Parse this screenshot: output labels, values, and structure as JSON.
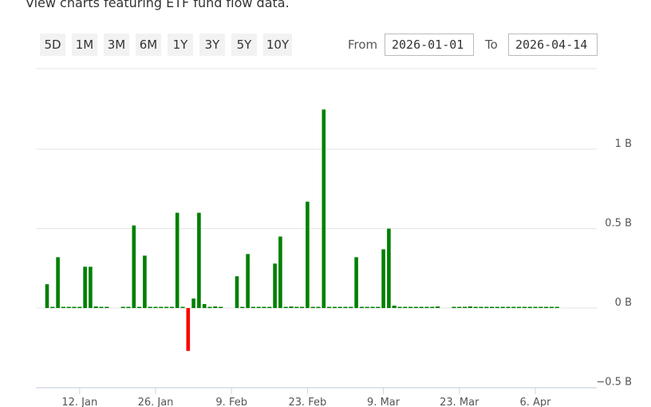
{
  "header": {
    "subtitle": "View charts featuring ETF fund flow data."
  },
  "range_buttons": [
    "5D",
    "1M",
    "3M",
    "6M",
    "1Y",
    "3Y",
    "5Y",
    "10Y"
  ],
  "date_range": {
    "from_label": "From",
    "from_value": "2026-01-01",
    "to_label": "To",
    "to_value": "2026-04-14"
  },
  "colors": {
    "positive": "#008000",
    "negative": "#ff0000"
  },
  "chart_data": {
    "type": "bar",
    "title": "",
    "xlabel": "",
    "ylabel": "",
    "x_type": "date",
    "x_range": [
      "2026-01-06",
      "2026-04-10"
    ],
    "ylim": [
      -0.5,
      1.25
    ],
    "yunit": "B",
    "y_ticks": [
      -0.5,
      0,
      0.5,
      1
    ],
    "y_tick_labels": [
      "−0.5 B",
      "0 B",
      "0.5 B",
      "1 B"
    ],
    "x_ticks": [
      "2026-01-12",
      "2026-01-26",
      "2026-02-09",
      "2026-02-23",
      "2026-03-09",
      "2026-03-23",
      "2026-04-06"
    ],
    "x_tick_labels": [
      "12. Jan",
      "26. Jan",
      "9. Feb",
      "23. Feb",
      "9. Mar",
      "23. Mar",
      "6. Apr"
    ],
    "grid": true,
    "legend": false,
    "x": [
      "2026-01-06",
      "2026-01-07",
      "2026-01-08",
      "2026-01-09",
      "2026-01-10",
      "2026-01-11",
      "2026-01-12",
      "2026-01-13",
      "2026-01-14",
      "2026-01-15",
      "2026-01-16",
      "2026-01-17",
      "2026-01-18",
      "2026-01-19",
      "2026-01-20",
      "2026-01-21",
      "2026-01-22",
      "2026-01-23",
      "2026-01-24",
      "2026-01-25",
      "2026-01-26",
      "2026-01-27",
      "2026-01-28",
      "2026-01-29",
      "2026-01-30",
      "2026-01-31",
      "2026-02-01",
      "2026-02-02",
      "2026-02-03",
      "2026-02-04",
      "2026-02-05",
      "2026-02-06",
      "2026-02-07",
      "2026-02-08",
      "2026-02-09",
      "2026-02-10",
      "2026-02-11",
      "2026-02-12",
      "2026-02-13",
      "2026-02-14",
      "2026-02-15",
      "2026-02-16",
      "2026-02-17",
      "2026-02-18",
      "2026-02-19",
      "2026-02-20",
      "2026-02-21",
      "2026-02-22",
      "2026-02-23",
      "2026-02-24",
      "2026-02-25",
      "2026-02-26",
      "2026-02-27",
      "2026-02-28",
      "2026-03-01",
      "2026-03-02",
      "2026-03-03",
      "2026-03-04",
      "2026-03-05",
      "2026-03-06",
      "2026-03-07",
      "2026-03-08",
      "2026-03-09",
      "2026-03-10",
      "2026-03-11",
      "2026-03-12",
      "2026-03-13",
      "2026-03-14",
      "2026-03-15",
      "2026-03-16",
      "2026-03-17",
      "2026-03-18",
      "2026-03-19",
      "2026-03-20",
      "2026-03-21",
      "2026-03-22",
      "2026-03-23",
      "2026-03-24",
      "2026-03-25",
      "2026-03-26",
      "2026-03-27",
      "2026-03-28",
      "2026-03-29",
      "2026-03-30",
      "2026-03-31",
      "2026-04-01",
      "2026-04-02",
      "2026-04-03",
      "2026-04-04",
      "2026-04-05",
      "2026-04-06",
      "2026-04-07",
      "2026-04-08",
      "2026-04-09",
      "2026-04-10"
    ],
    "values": [
      0.15,
      0.005,
      0.32,
      0.005,
      0.005,
      0.005,
      0.005,
      0.26,
      0.26,
      0.01,
      0.005,
      0.005,
      0,
      0,
      0.005,
      0.005,
      0.52,
      0.005,
      0.33,
      0.005,
      0.005,
      0.005,
      0.005,
      0.005,
      0.6,
      0.005,
      -0.27,
      0.06,
      0.6,
      0.025,
      0.005,
      0.01,
      0.005,
      0,
      0,
      0.2,
      0.005,
      0.34,
      0.005,
      0.005,
      0.005,
      0.005,
      0.28,
      0.45,
      0.005,
      0.01,
      0.005,
      0.005,
      0.67,
      0.005,
      0.005,
      1.25,
      0.005,
      0.005,
      0.005,
      0.005,
      0.005,
      0.32,
      0.005,
      0.005,
      0.005,
      0.005,
      0.37,
      0.5,
      0.015,
      0.005,
      0.005,
      0.005,
      0.005,
      0.005,
      0.005,
      0.005,
      0.01,
      0,
      0,
      0.005,
      0.005,
      0.005,
      0.01,
      0.005,
      0.005,
      0.005,
      0.005,
      0.005,
      0.005,
      0.005,
      0.005,
      0.005,
      0.005,
      0.005,
      0.005,
      0.005,
      0.005,
      0.005,
      0.005
    ]
  }
}
